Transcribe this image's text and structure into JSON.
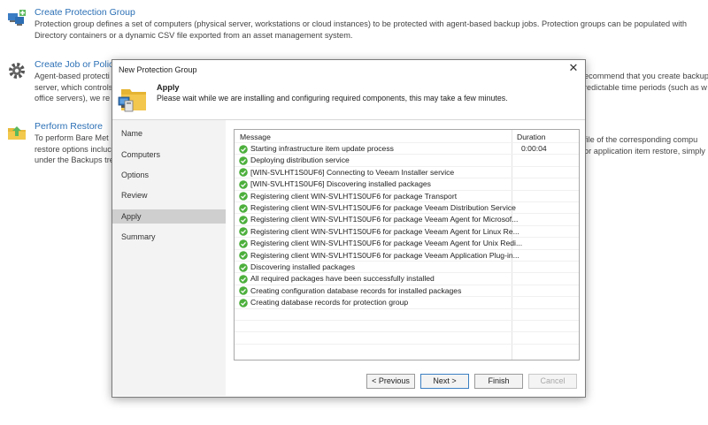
{
  "background": {
    "sections": [
      {
        "title": "Create Protection Group",
        "lines": [
          "Protection group defines a set of computers (physical server, workstations or cloud instances) to be protected with agent-based backup jobs. Protection groups can be populated with",
          "Directory containers or a dynamic CSV file exported from an asset management system."
        ],
        "icon": "protection-group-icon"
      },
      {
        "title": "Create Job or Policy",
        "lines": [
          "Agent-based protecti",
          "server, which controls",
          "office servers), we re"
        ],
        "right_lines": [
          "ecommend that you create backup",
          "redictable time periods (such as w"
        ],
        "icon": "gear-icon"
      },
      {
        "title": "Perform Restore",
        "lines": [
          "To perform Bare Met",
          "restore options incluc",
          "under the Backups tre"
        ],
        "right_lines": [
          "file of the corresponding compu",
          "or application item restore, simply"
        ],
        "icon": "restore-icon"
      }
    ]
  },
  "dialog": {
    "title": "New Protection Group",
    "close_glyph": "✕",
    "header": {
      "step_title": "Apply",
      "subtitle": "Please wait while we are installing and configuring required components, this may take a few minutes."
    },
    "nav": [
      "Name",
      "Computers",
      "Options",
      "Review",
      "Apply",
      "Summary"
    ],
    "active_nav": "Apply",
    "log": {
      "columns": {
        "message": "Message",
        "duration": "Duration"
      },
      "rows": [
        {
          "message": "Starting infrastructure item update process",
          "duration": "0:00:04",
          "status": "success"
        },
        {
          "message": "Deploying distribution service",
          "duration": "",
          "status": "success"
        },
        {
          "message": "[WIN-SVLHT1S0UF6] Connecting to Veeam Installer service",
          "duration": "",
          "status": "success"
        },
        {
          "message": "[WIN-SVLHT1S0UF6] Discovering installed packages",
          "duration": "",
          "status": "success"
        },
        {
          "message": "Registering client WIN-SVLHT1S0UF6 for package Transport",
          "duration": "",
          "status": "success"
        },
        {
          "message": "Registering client WIN-SVLHT1S0UF6 for package Veeam Distribution Service",
          "duration": "",
          "status": "success"
        },
        {
          "message": "Registering client WIN-SVLHT1S0UF6 for package Veeam Agent for Microsof...",
          "duration": "",
          "status": "success"
        },
        {
          "message": "Registering client WIN-SVLHT1S0UF6 for package Veeam Agent for Linux Re...",
          "duration": "",
          "status": "success"
        },
        {
          "message": "Registering client WIN-SVLHT1S0UF6 for package Veeam Agent for Unix Redi...",
          "duration": "",
          "status": "success"
        },
        {
          "message": "Registering client WIN-SVLHT1S0UF6 for package Veeam Application Plug-in...",
          "duration": "",
          "status": "success"
        },
        {
          "message": "Discovering installed packages",
          "duration": "",
          "status": "success"
        },
        {
          "message": "All required packages have been successfully installed",
          "duration": "",
          "status": "success"
        },
        {
          "message": "Creating configuration database records for installed packages",
          "duration": "",
          "status": "success"
        },
        {
          "message": "Creating database records for protection group",
          "duration": "",
          "status": "success"
        }
      ]
    },
    "buttons": {
      "previous": "< Previous",
      "next": "Next >",
      "finish": "Finish",
      "cancel": "Cancel"
    }
  },
  "colors": {
    "link": "#2a6fb5",
    "success": "#4caf3c",
    "nav_active": "#cfcfcf",
    "primary_border": "#3c7fc1"
  }
}
